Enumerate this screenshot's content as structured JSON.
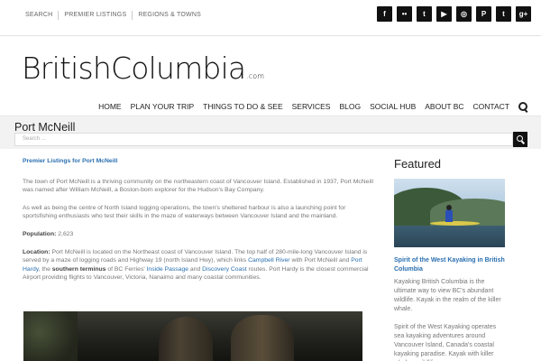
{
  "topbar": {
    "links": [
      "SEARCH",
      "PREMIER LISTINGS",
      "REGIONS & TOWNS"
    ],
    "social": [
      {
        "name": "facebook-icon",
        "glyph": "f"
      },
      {
        "name": "flickr-icon",
        "glyph": "••"
      },
      {
        "name": "twitter-icon",
        "glyph": "t"
      },
      {
        "name": "youtube-icon",
        "glyph": "▶"
      },
      {
        "name": "instagram-icon",
        "glyph": "◎"
      },
      {
        "name": "pinterest-icon",
        "glyph": "P"
      },
      {
        "name": "tumblr-icon",
        "glyph": "t"
      },
      {
        "name": "googleplus-icon",
        "glyph": "g+"
      }
    ]
  },
  "logo": {
    "text": "BritishColumbia",
    "suffix": ".com"
  },
  "nav": {
    "items": [
      "HOME",
      "PLAN YOUR TRIP",
      "THINGS TO DO & SEE",
      "SERVICES",
      "BLOG",
      "SOCIAL HUB",
      "ABOUT BC",
      "CONTACT"
    ],
    "search_icon": "search-icon"
  },
  "page": {
    "title": "Port McNeill",
    "search_placeholder": "Search ..."
  },
  "content": {
    "premier_link": "Premier Listings for Port McNeill",
    "para1": "The town of Port McNeill is a thriving community on the northeastern coast of Vancouver Island. Established in 1937, Port McNeill was named after William McNeill, a Boston-born explorer for the Hudson's Bay Company.",
    "para2": "As well as being the centre of North Island logging operations, the town's sheltered harbour is also a launching point for sportsfishing enthusiasts who test their skills in the maze of waterways between Vancouver Island and the mainland.",
    "population_label": "Population:",
    "population_value": "2,623",
    "location": {
      "label": "Location:",
      "t1": "Port McNeill is located on the Northeast coast of Vancouver Island. The top half of 280-mile-long Vancouver Island is served by a maze of logging roads and Highway 19 (north Island Hwy), which links ",
      "link1": "Campbell River",
      "t2": " with Port McNeill and ",
      "link2": "Port Hardy",
      "t3": ", the ",
      "strong1": "southern terminus",
      "t4": " of BC Ferries' ",
      "link3": "Inside Passage",
      "t5": " and ",
      "link4": "Discovery Coast",
      "t6": " routes. Port Hardy is the closest commercial Airport providing flights to Vancouver, Victoria, Nanaimo and many coastal communities."
    }
  },
  "sidebar": {
    "heading": "Featured",
    "link": "Spirit of the West Kayaking in British Columbia",
    "para1": "Kayaking British Columbia is the ultimate way to view BC's abundant wildlife. Kayak in the realm of the killer whale.",
    "para2": "Spirit of the West Kayaking operates sea kayaking adventures around Vancouver Island, Canada's coastal kayaking paradise. Kayak with killer whales, wildlife"
  },
  "colors": {
    "link": "#2a6fb0",
    "dark": "#111111",
    "titlebar_bg": "#f2f2f2"
  }
}
